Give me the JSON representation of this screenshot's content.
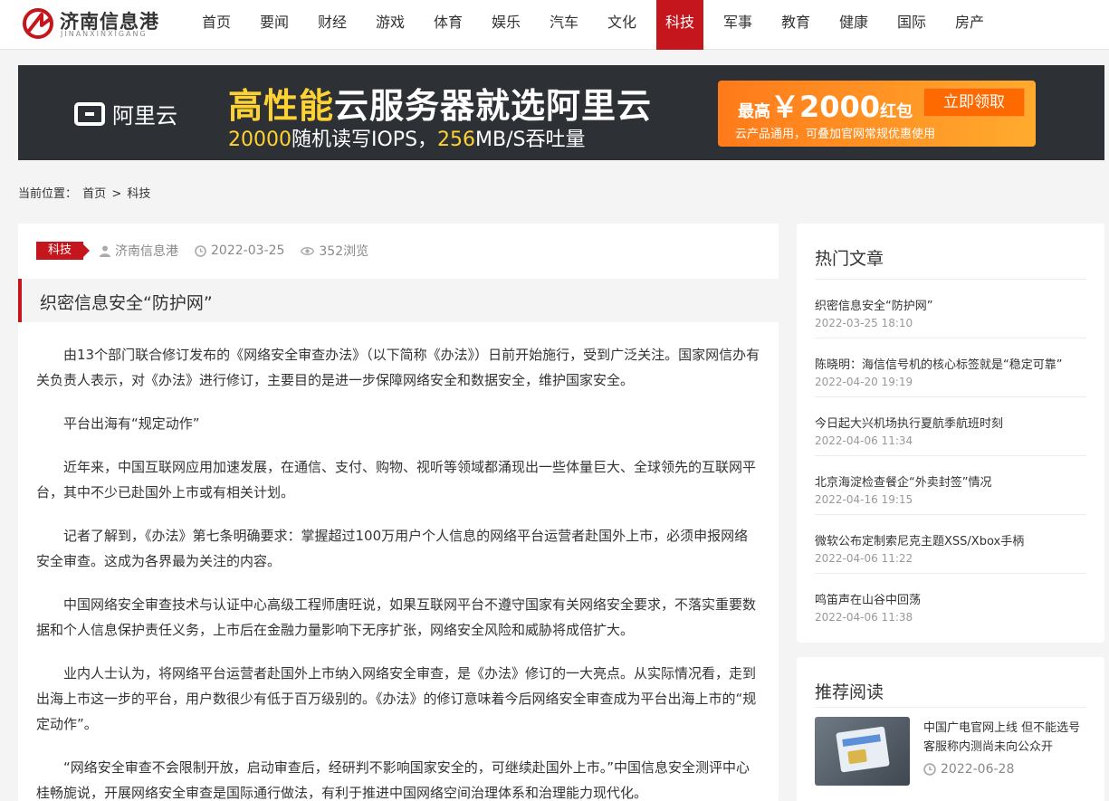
{
  "site": {
    "name": "济南信息港",
    "pinyin": "JINANXINXIGANG"
  },
  "nav": [
    {
      "label": "首页"
    },
    {
      "label": "要闻"
    },
    {
      "label": "财经"
    },
    {
      "label": "游戏"
    },
    {
      "label": "体育"
    },
    {
      "label": "娱乐"
    },
    {
      "label": "汽车"
    },
    {
      "label": "文化"
    },
    {
      "label": "科技",
      "active": true
    },
    {
      "label": "军事"
    },
    {
      "label": "教育"
    },
    {
      "label": "健康"
    },
    {
      "label": "国际"
    },
    {
      "label": "房产"
    }
  ],
  "banner": {
    "brand": "阿里云",
    "headline_highlight": "高性能",
    "headline_rest": "云服务器就选阿里云",
    "sub_num1": "20000",
    "sub_text1": "随机读写IOPS，",
    "sub_num2": "256",
    "sub_text2": "MB/S吞吐量",
    "promo_prefix": "最高",
    "promo_amount": "￥2000",
    "promo_suffix": "红包",
    "promo_button": "立即领取",
    "promo_note": "云产品通用，可叠加官网常规优惠使用"
  },
  "breadcrumb": {
    "prefix": "当前位置：",
    "home": "首页",
    "sep": ">",
    "current": "科技"
  },
  "article": {
    "category": "科技",
    "author": "济南信息港",
    "date": "2022-03-25",
    "views": "352浏览",
    "title": "织密信息安全“防护网”",
    "paragraphs": [
      "由13个部门联合修订发布的《网络安全审查办法》（以下简称《办法》）日前开始施行，受到广泛关注。国家网信办有关负责人表示，对《办法》进行修订，主要目的是进一步保障网络安全和数据安全，维护国家安全。",
      "平台出海有“规定动作”",
      "近年来，中国互联网应用加速发展，在通信、支付、购物、视听等领域都涌现出一些体量巨大、全球领先的互联网平台，其中不少已赴国外上市或有相关计划。",
      "记者了解到，《办法》第七条明确要求：掌握超过100万用户个人信息的网络平台运营者赴国外上市，必须申报网络安全审查。这成为各界最为关注的内容。",
      "中国网络安全审查技术与认证中心高级工程师唐旺说，如果互联网平台不遵守国家有关网络安全要求，不落实重要数据和个人信息保护责任义务，上市后在金融力量影响下无序扩张，网络安全风险和威胁将成倍扩大。",
      "业内人士认为，将网络平台运营者赴国外上市纳入网络安全审查，是《办法》修订的一大亮点。从实际情况看，走到出海上市这一步的平台，用户数很少有低于百万级别的。《办法》的修订意味着今后网络安全审查成为平台出海上市的“规定动作”。",
      "“网络安全审查不会限制开放，启动审查后，经研判不影响国家安全的，可继续赴国外上市。”中国信息安全测评中心桂畅旎说，开展网络安全审查是国际通行做法，有利于推进中国网络空间治理体系和治理能力现代化。"
    ]
  },
  "hot": {
    "title": "热门文章",
    "items": [
      {
        "title": "织密信息安全“防护网”",
        "date": "2022-03-25 18:10"
      },
      {
        "title": "陈晓明：海信信号机的核心标签就是“稳定可靠”",
        "date": "2022-04-20 19:19"
      },
      {
        "title": "今日起大兴机场执行夏航季航班时刻",
        "date": "2022-04-06 11:34"
      },
      {
        "title": "北京海淀检查餐企“外卖封签”情况",
        "date": "2022-04-16 19:15"
      },
      {
        "title": "微软公布定制索尼克主题XSS/Xbox手柄",
        "date": "2022-04-06 11:22"
      },
      {
        "title": "鸣笛声在山谷中回荡",
        "date": "2022-04-06 11:38"
      }
    ]
  },
  "recommend": {
    "title": "推荐阅读",
    "items": [
      {
        "title": "中国广电官网上线 但不能选号 客服称内测尚未向公众开",
        "date": "2022-06-28"
      }
    ]
  },
  "colors": {
    "accent": "#c4161c",
    "banner_bg": "#2d3136",
    "banner_highlight": "#ffd233",
    "promo": "#ff8a1f"
  }
}
